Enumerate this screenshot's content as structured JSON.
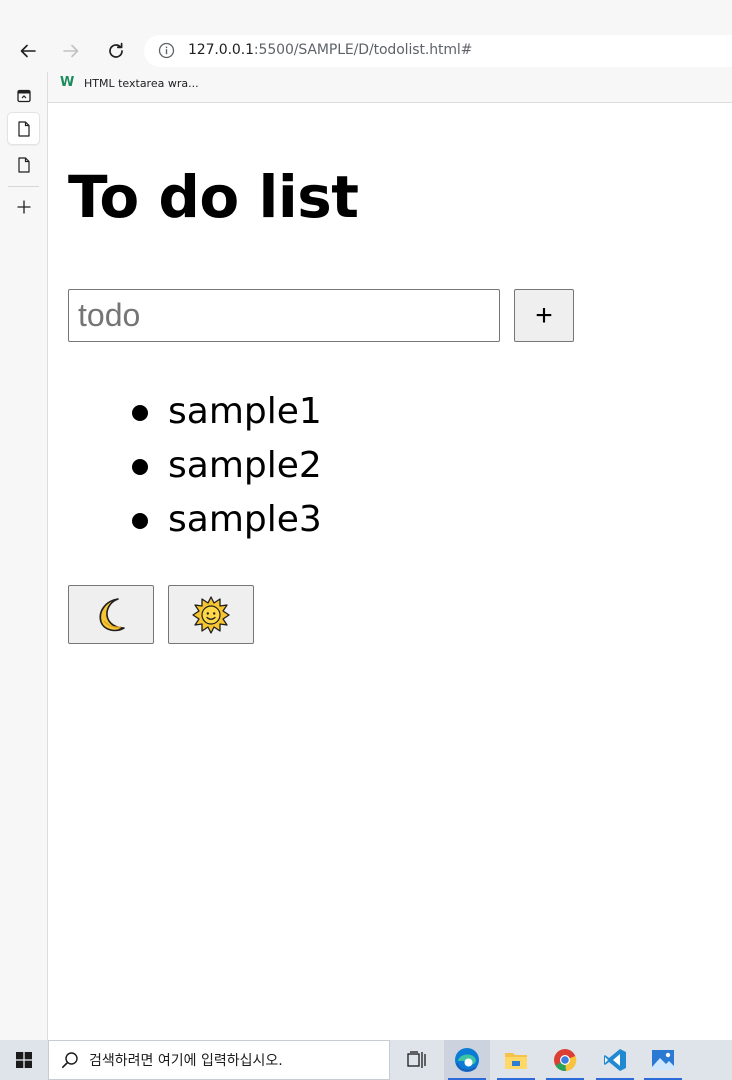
{
  "browser": {
    "url_host": "127.0.0.1",
    "url_rest": ":5500/SAMPLE/D/todolist.html#",
    "bookmark_label": "HTML textarea wra..."
  },
  "page": {
    "title": "To do list",
    "input_placeholder": "todo",
    "input_value": "",
    "add_button_label": "+",
    "todos": [
      "sample1",
      "sample2",
      "sample3"
    ],
    "moon_button_label": "🌙",
    "sun_button_label": "🌞"
  },
  "taskbar": {
    "search_placeholder": "검색하려면 여기에 입력하십시오."
  },
  "colors": {
    "edge_blue": "#0b7bd6",
    "vscode_blue": "#1f8ad2",
    "button_face": "#efefef"
  }
}
